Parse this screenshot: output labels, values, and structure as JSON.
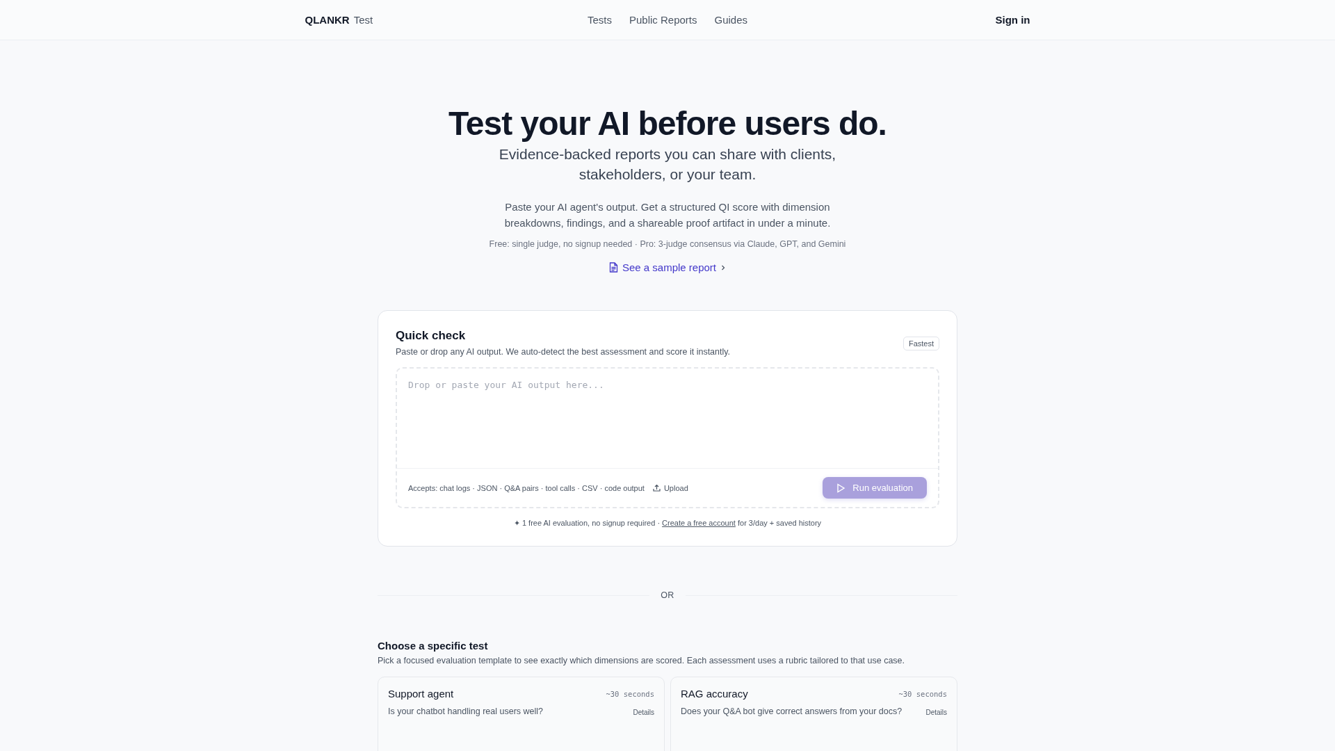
{
  "header": {
    "logo": "QLANKR",
    "logo_suffix": "Test",
    "nav": [
      {
        "label": "Tests"
      },
      {
        "label": "Public Reports"
      },
      {
        "label": "Guides"
      }
    ],
    "sign_in": "Sign in"
  },
  "hero": {
    "title": "Test your AI before users do.",
    "subtitle": "Evidence-backed reports you can share with clients, stakeholders, or your team.",
    "description": "Paste your AI agent's output. Get a structured QI score with dimension breakdowns, findings, and a shareable proof artifact in under a minute.",
    "tiers": "Free: single judge, no signup needed · Pro: 3-judge consensus via Claude, GPT, and Gemini",
    "sample_link": "See a sample report"
  },
  "quick_check": {
    "title": "Quick check",
    "description": "Paste or drop any AI output. We auto-detect the best assessment and score it instantly.",
    "badge": "Fastest",
    "placeholder": "Drop or paste your AI output here...",
    "accepts": "Accepts: chat logs · JSON · Q&A pairs · tool calls · CSV · code output",
    "upload": "Upload",
    "run_button": {
      "label": "Run evaluation",
      "disabled": true
    },
    "note_before": "✦ 1 free AI evaluation, no signup required ·",
    "note_link": "Create a free account",
    "note_after": "for 3/day + saved history"
  },
  "divider": "OR",
  "tests": {
    "title": "Choose a specific test",
    "description": "Pick a focused evaluation template to see exactly which dimensions are scored. Each assessment uses a rubric tailored to that use case.",
    "cards": [
      {
        "title": "Support agent",
        "time": "~30 seconds",
        "question": "Is your chatbot handling real users well?",
        "details": "Details"
      },
      {
        "title": "RAG accuracy",
        "time": "~30 seconds",
        "question": "Does your Q&A bot give correct answers from your docs?",
        "details": "Details"
      }
    ]
  }
}
